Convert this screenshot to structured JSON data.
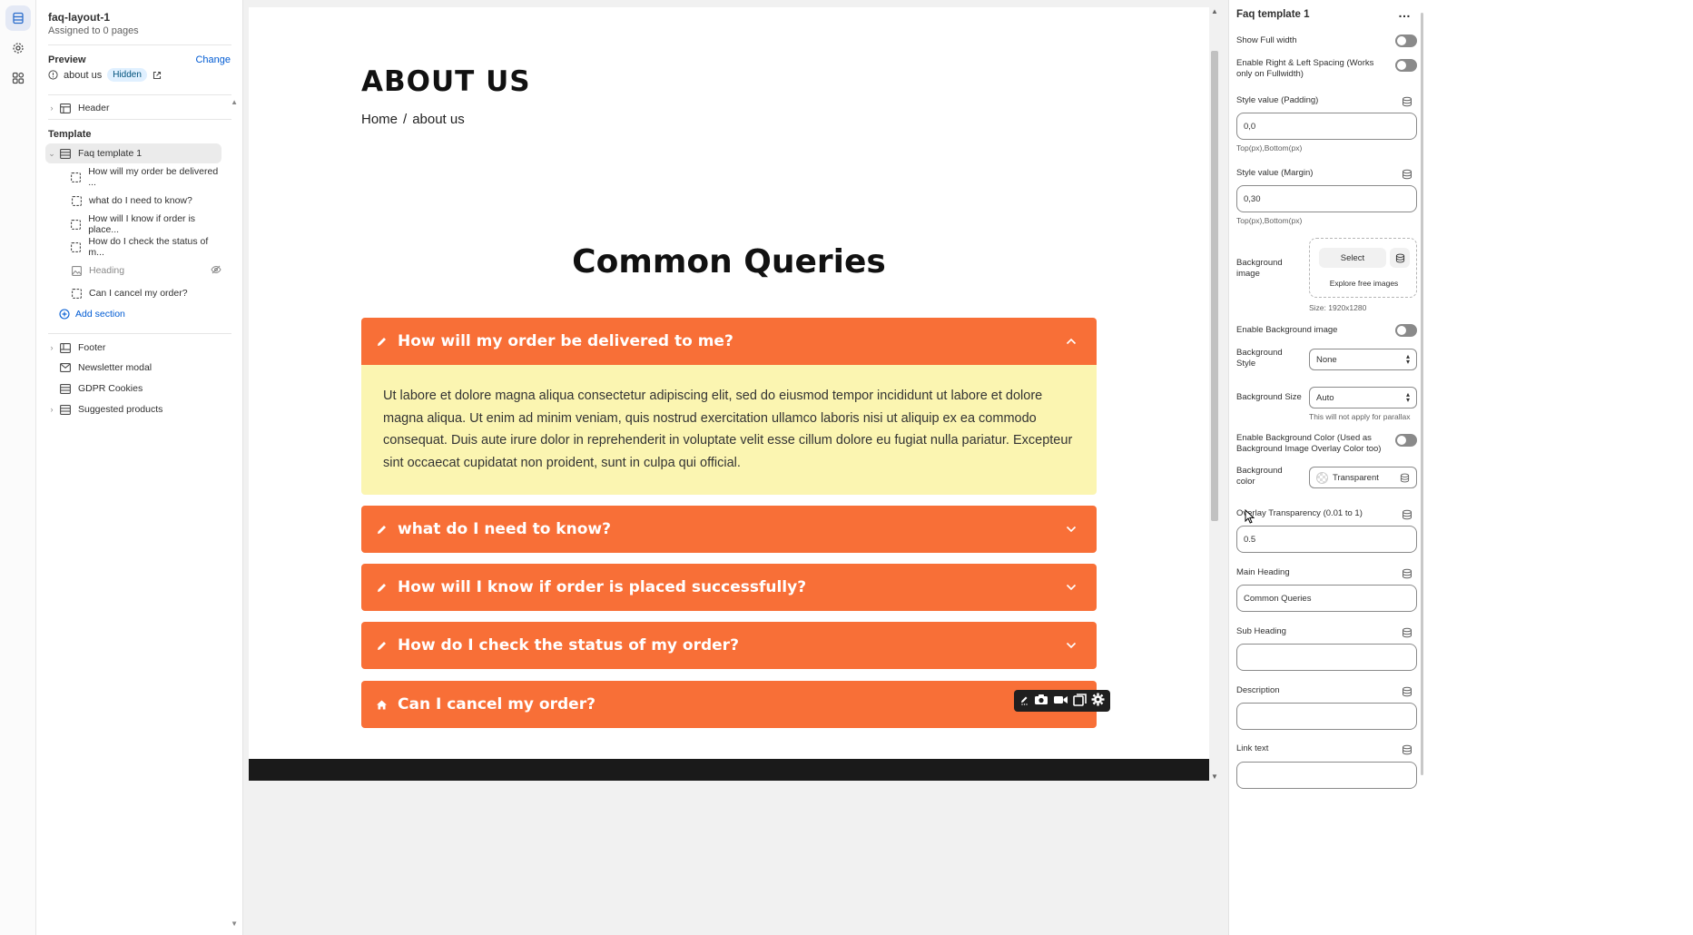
{
  "rail": {
    "icons": [
      "sections-icon",
      "settings-icon",
      "apps-icon"
    ]
  },
  "sidebar": {
    "template_name": "faq-layout-1",
    "assigned": "Assigned to 0 pages",
    "preview_label": "Preview",
    "change_label": "Change",
    "preview_page": "about us",
    "preview_badge": "Hidden",
    "header_item": "Header",
    "template_label": "Template",
    "selected_section": "Faq template 1",
    "blocks": [
      "How will my order be delivered ...",
      "what do I need to know?",
      "How will I know if order is place...",
      "How do I check the status of m...",
      "Heading",
      "Can I cancel my order?"
    ],
    "add_section": "Add section",
    "footer_items": [
      "Footer",
      "Newsletter modal",
      "GDPR Cookies",
      "Suggested products"
    ]
  },
  "page": {
    "title": "ABOUT US",
    "breadcrumb_home": "Home",
    "breadcrumb_sep": "/",
    "breadcrumb_current": "about us",
    "faq_heading": "Common Queries",
    "faqs": [
      {
        "question": "How will my order be delivered to me?",
        "answer": "Ut labore et dolore magna aliqua consectetur adipiscing elit, sed do eiusmod tempor incididunt ut labore et dolore magna aliqua. Ut enim ad minim veniam, quis nostrud exercitation ullamco laboris nisi ut aliquip ex ea commodo consequat. Duis aute irure dolor in reprehenderit in voluptate velit esse cillum dolore eu fugiat nulla pariatur. Excepteur sint occaecat cupidatat non proident, sunt in culpa qui official."
      },
      {
        "question": "what do I need to know?"
      },
      {
        "question": "How will I know if order is placed successfully?"
      },
      {
        "question": "How do I check the status of my order?"
      },
      {
        "question": "Can I cancel my order?"
      }
    ]
  },
  "settings": {
    "title": "Faq template 1",
    "more": "…",
    "show_full_width": "Show Full width",
    "enable_spacing": "Enable Right & Left Spacing (Works only on Fullwidth)",
    "padding_label": "Style value (Padding)",
    "padding_value": "0,0",
    "padding_help": "Top(px),Bottom(px)",
    "margin_label": "Style value (Margin)",
    "margin_value": "0,30",
    "margin_help": "Top(px),Bottom(px)",
    "bg_image_label": "Background image",
    "bg_select": "Select",
    "bg_explore": "Explore free images",
    "bg_size_note": "Size: 1920x1280",
    "enable_bg_image": "Enable Background image",
    "bg_style_label": "Background Style",
    "bg_style_value": "None",
    "bg_size_label": "Background Size",
    "bg_size_value": "Auto",
    "bg_size_help": "This will not apply for parallax",
    "enable_bg_color": "Enable Background Color (Used as Background Image Overlay Color too)",
    "bg_color_label": "Background color",
    "bg_color_value": "Transparent",
    "overlay_label": "Overlay Transparency (0.01 to 1)",
    "overlay_value": "0.5",
    "main_heading_label": "Main Heading",
    "main_heading_value": "Common Queries",
    "sub_heading_label": "Sub Heading",
    "sub_heading_value": "",
    "description_label": "Description",
    "description_value": "",
    "link_text_label": "Link text",
    "link_text_value": ""
  },
  "colors": {
    "accent_orange": "#f86f37",
    "answer_bg": "#fbf5b1",
    "link_blue": "#005bd3"
  }
}
